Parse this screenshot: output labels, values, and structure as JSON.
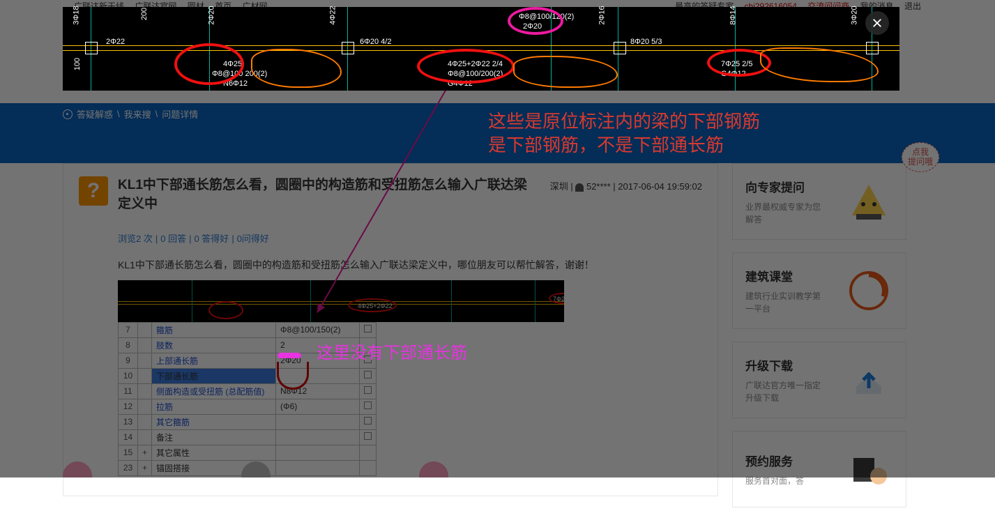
{
  "topnav": {
    "links_left": [
      "广联达新干线",
      "广联达官网",
      "圆材",
      "首页",
      "广材网"
    ],
    "links_right_1": "最高的答疑专家",
    "links_right_2": "chi292616054",
    "links_right_3": "交流问问商",
    "links_right_4": "我的消息",
    "links_right_5": "退出"
  },
  "breadcrumb": {
    "a": "答疑解惑",
    "b": "我来搜",
    "c": "问题详情"
  },
  "question": {
    "icon": "?",
    "title": "KL1中下部通长筋怎么看，圆圈中的构造筋和受扭筋怎么输入广联达梁定义中",
    "city": "深圳",
    "user": "52****",
    "time": "2017-06-04 19:59:02",
    "stats": {
      "views": "浏览2 次",
      "answers": "0 回答",
      "good": "0 答得好",
      "ask": "0问得好"
    },
    "desc": "KL1中下部通长筋怎么看，圆圈中的构造筋和受扭筋怎么输入广联达梁定义中，哪位朋友可以帮忙解答，谢谢！"
  },
  "cad_labels": {
    "t1": "Φ8@100/120(2)",
    "t2": "2Φ20",
    "b1": "4Φ25",
    "b2": "Φ8@100 200(2)",
    "b3": "N6Φ12",
    "m1": "4Φ25+2Φ22 2/4",
    "m2": "Φ8@100/200(2)",
    "m3": "G4Φ12",
    "r1": "7Φ25 2/5",
    "r2": "G4Φ12",
    "d1": "3Φ18",
    "d2": "2Φ22",
    "d3": "200",
    "d4": "100",
    "d5": "2Φ20",
    "d6": "4Φ22",
    "d7": "6Φ20 4/2",
    "d8": "8Φ20 5/3",
    "d9": "2Φ16",
    "d10": "8Φ14",
    "d11": "3Φ20"
  },
  "prop_rows": [
    {
      "n": "7",
      "label": "箍筋",
      "val": "Φ8@100/150(2)",
      "chk": true,
      "link": true
    },
    {
      "n": "8",
      "label": "肢数",
      "val": "2",
      "chk": false,
      "link": true
    },
    {
      "n": "9",
      "label": "上部通长筋",
      "val": "2Φ20",
      "chk": true,
      "link": true
    },
    {
      "n": "10",
      "label": "下部通长筋",
      "val": "",
      "chk": true,
      "hl": true
    },
    {
      "n": "11",
      "label": "侧面构造或受扭筋 (总配筋值)",
      "val": "N8Φ12",
      "chk": true,
      "link": true
    },
    {
      "n": "12",
      "label": "拉筋",
      "val": "(Φ6)",
      "chk": true,
      "link": true
    },
    {
      "n": "13",
      "label": "其它箍筋",
      "val": "",
      "chk": true,
      "link": true
    },
    {
      "n": "14",
      "label": "备注",
      "val": "",
      "chk": true,
      "link": false
    },
    {
      "n": "15",
      "label": "其它属性",
      "val": "",
      "expand": "+",
      "gray": true
    },
    {
      "n": "23",
      "label": "锚固搭接",
      "val": "",
      "expand": "+",
      "gray": true
    }
  ],
  "annotations": {
    "a1": "这些是原位标注内的梁的下部钢筋",
    "a2": "是下部钢筋，不是下部通长筋",
    "a3": "这里没有下部通长筋"
  },
  "sidebar": {
    "bubble": "点我\n提问哦",
    "cards": [
      {
        "title": "向专家提问",
        "desc": "业界最权威专家为您解答"
      },
      {
        "title": "建筑课堂",
        "desc": "建筑行业实训教学第一平台"
      },
      {
        "title": "升级下载",
        "desc": "广联达官方唯一指定升级下载"
      },
      {
        "title": "预约服务",
        "desc": "服务首对面，答"
      }
    ]
  }
}
